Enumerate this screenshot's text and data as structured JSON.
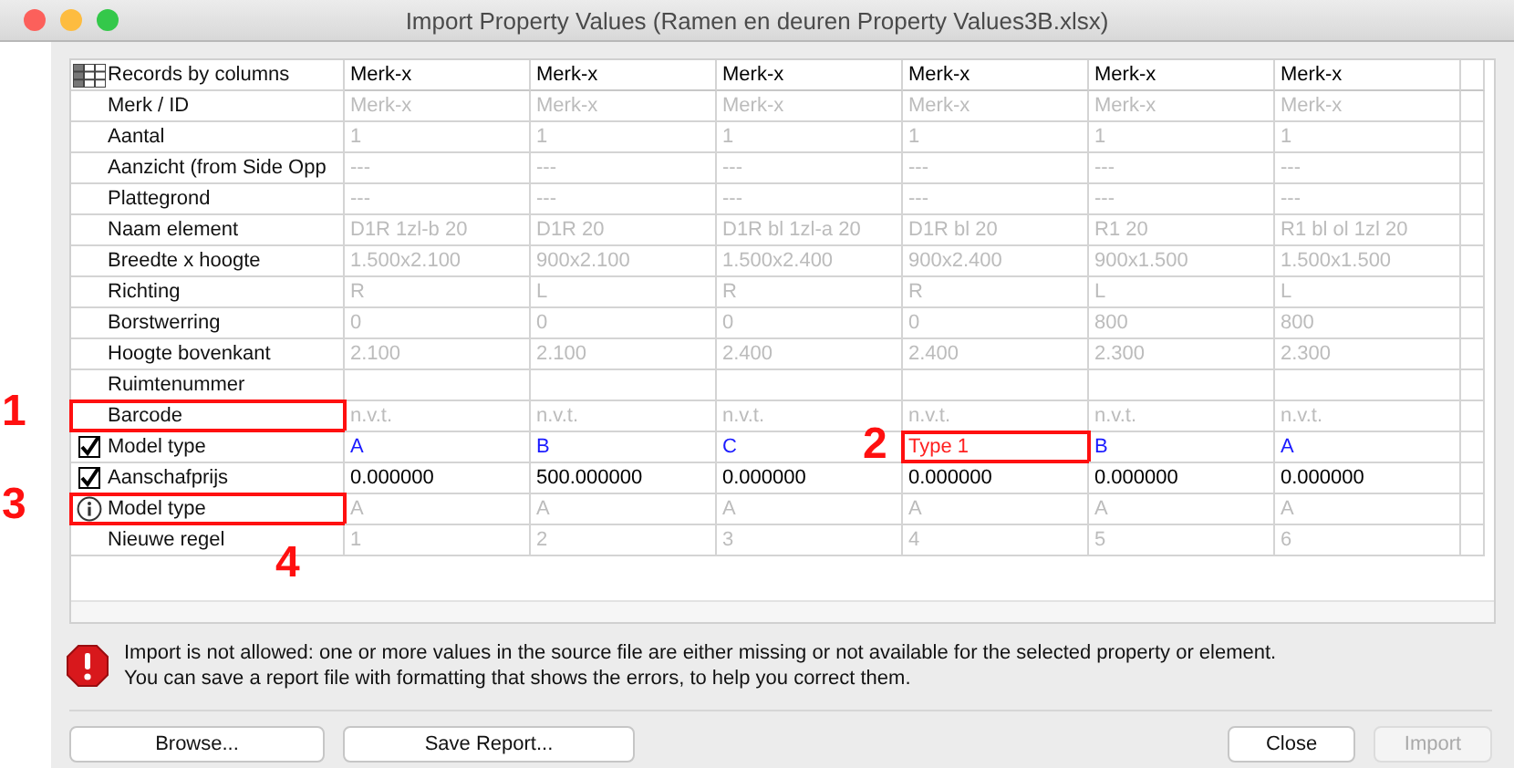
{
  "window": {
    "title": "Import Property Values (Ramen en deuren Property Values3B.xlsx)"
  },
  "table": {
    "corner": "Records by columns",
    "columns": [
      "Merk-x",
      "Merk-x",
      "Merk-x",
      "Merk-x",
      "Merk-x",
      "Merk-x"
    ],
    "rows": [
      {
        "label": "Merk / ID",
        "color": "#bcbcbc",
        "cells": [
          "Merk-x",
          "Merk-x",
          "Merk-x",
          "Merk-x",
          "Merk-x",
          "Merk-x"
        ]
      },
      {
        "label": "Aantal",
        "color": "#bcbcbc",
        "cells": [
          "1",
          "1",
          "1",
          "1",
          "1",
          "1"
        ]
      },
      {
        "label": "Aanzicht (from Side Opp",
        "color": "#bcbcbc",
        "cells": [
          "---",
          "---",
          "---",
          "---",
          "---",
          "---"
        ]
      },
      {
        "label": "Plattegrond",
        "color": "#bcbcbc",
        "cells": [
          "---",
          "---",
          "---",
          "---",
          "---",
          "---"
        ]
      },
      {
        "label": "Naam element",
        "color": "#bcbcbc",
        "cells": [
          "D1R 1zl-b 20",
          "D1R 20",
          "D1R bl 1zl-a 20",
          "D1R bl 20",
          "R1 20",
          "R1 bl ol 1zl 20"
        ]
      },
      {
        "label": "Breedte x hoogte",
        "color": "#bcbcbc",
        "cells": [
          "1.500x2.100",
          "900x2.100",
          "1.500x2.400",
          "900x2.400",
          "900x1.500",
          "1.500x1.500"
        ]
      },
      {
        "label": "Richting",
        "color": "#bcbcbc",
        "cells": [
          "R",
          "L",
          "R",
          "R",
          "L",
          "L"
        ]
      },
      {
        "label": "Borstwerring",
        "color": "#bcbcbc",
        "cells": [
          "0",
          "0",
          "0",
          "0",
          "800",
          "800"
        ]
      },
      {
        "label": "Hoogte bovenkant",
        "color": "#bcbcbc",
        "cells": [
          "2.100",
          "2.100",
          "2.400",
          "2.400",
          "2.300",
          "2.300"
        ]
      },
      {
        "label": "Ruimtenummer",
        "cells": []
      },
      {
        "label": "Barcode",
        "color": "#bcbcbc",
        "highlight": true,
        "annotation": "1",
        "cells": [
          "n.v.t.",
          "n.v.t.",
          "n.v.t.",
          "n.v.t.",
          "n.v.t.",
          "n.v.t."
        ]
      },
      {
        "label": "Model type",
        "kind": "checkbox",
        "checked": true,
        "color": "#1a1aff",
        "cells": [
          "A",
          "B",
          "C",
          {
            "text": "Type 1",
            "error": true,
            "annotation": "2"
          },
          "B",
          "A"
        ]
      },
      {
        "label": "Aanschafprijs",
        "kind": "checkbox",
        "checked": true,
        "color": "#000000",
        "cells": [
          "0.000000",
          "500.000000",
          "0.000000",
          "0.000000",
          "0.000000",
          "0.000000"
        ]
      },
      {
        "label": "Model type",
        "kind": "info",
        "color": "#bcbcbc",
        "highlight": true,
        "annotation": "3",
        "cells": [
          "A",
          "A",
          "A",
          "A",
          "A",
          "A"
        ]
      },
      {
        "label": "Nieuwe regel",
        "color": "#bcbcbc",
        "cells": [
          "1",
          "2",
          "3",
          "4",
          "5",
          "6"
        ]
      }
    ],
    "footer_annotation": "4"
  },
  "message": {
    "text": "Import is not allowed: one or more values in the source file are either missing or not available for the selected property or element.\nYou can save a report file with formatting that shows the errors, to help you correct them."
  },
  "buttons_left": [
    {
      "label": "Browse...",
      "disabled": false
    },
    {
      "label": "Save Report...",
      "disabled": false
    }
  ],
  "buttons_right": [
    {
      "label": "Close",
      "disabled": false
    },
    {
      "label": "Import",
      "disabled": true
    }
  ]
}
